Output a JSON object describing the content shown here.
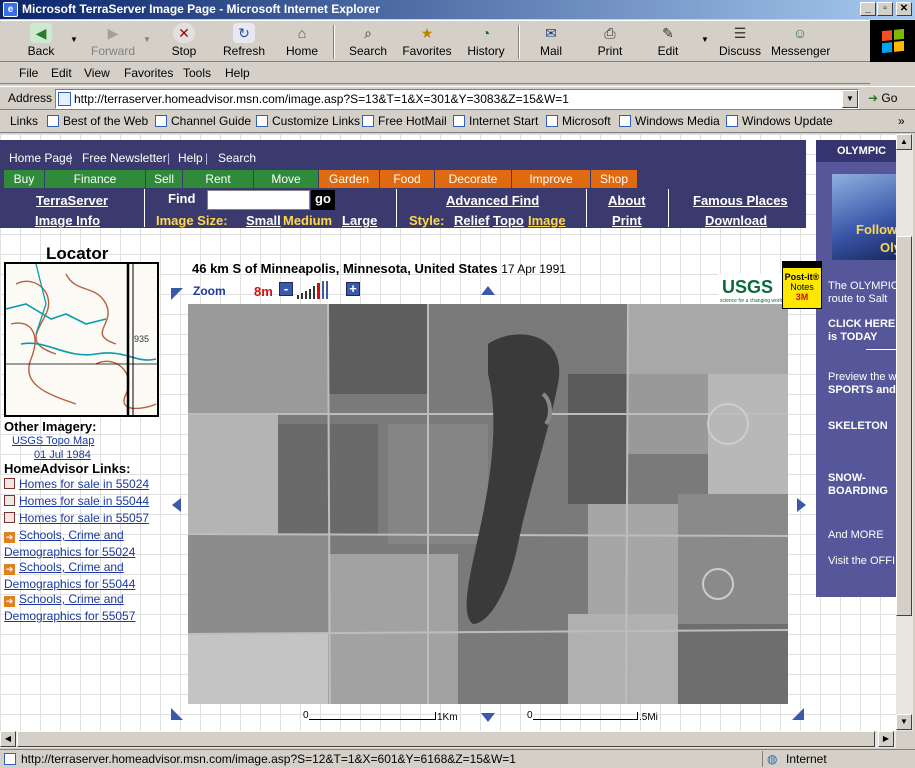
{
  "window": {
    "title": "Microsoft TerraServer Image Page - Microsoft Internet Explorer",
    "min": "_",
    "max": "▫",
    "close": "✕"
  },
  "toolbar": {
    "back": "Back",
    "forward": "Forward",
    "stop": "Stop",
    "refresh": "Refresh",
    "home": "Home",
    "search": "Search",
    "favorites": "Favorites",
    "history": "History",
    "mail": "Mail",
    "print": "Print",
    "edit": "Edit",
    "discuss": "Discuss",
    "messenger": "Messenger"
  },
  "menu": [
    "File",
    "Edit",
    "View",
    "Favorites",
    "Tools",
    "Help"
  ],
  "address": {
    "label": "Address",
    "url": "http://terraserver.homeadvisor.msn.com/image.asp?S=13&T=1&X=301&Y=3083&Z=15&W=1",
    "go": "Go"
  },
  "links": {
    "label": "Links",
    "items": [
      "Best of the Web",
      "Channel Guide",
      "Customize Links",
      "Free HotMail",
      "Internet Start",
      "Microsoft",
      "Windows Media",
      "Windows Update"
    ]
  },
  "site_nav": {
    "top": [
      "Home Page",
      "Free Newsletter",
      "Help",
      "Search"
    ],
    "categories": [
      "Buy",
      "Finance",
      "Sell",
      "Rent",
      "Move",
      "Garden",
      "Food",
      "Decorate",
      "Improve",
      "Shop"
    ],
    "terraserver": "TerraServer",
    "image_info": "Image Info",
    "find_label": "Find",
    "find_value": "",
    "go": "go",
    "image_size_label": "Image Size:",
    "size_small": "Small",
    "size_medium": "Medium",
    "size_large": "Large",
    "advanced_find": "Advanced Find",
    "style_label": "Style:",
    "style_relief": "Relief",
    "style_topo": "Topo",
    "style_image": "Image",
    "about": "About",
    "print": "Print",
    "famous_places": "Famous Places",
    "download": "Download"
  },
  "locator": {
    "title": "Locator",
    "map_label": "935",
    "other_imagery": "Other Imagery:",
    "topo_link": "USGS Topo Map",
    "topo_date": "01 Jul 1984",
    "homeadvisor_links": "HomeAdvisor Links:",
    "links": [
      {
        "type": "home",
        "text": "Homes for sale in 55024"
      },
      {
        "type": "home",
        "text": "Homes for sale in 55044"
      },
      {
        "type": "home",
        "text": "Homes for sale in 55057"
      },
      {
        "type": "arrow",
        "text": "Schools, Crime and",
        "text2": "Demographics for 55024"
      },
      {
        "type": "arrow",
        "text": "Schools, Crime and",
        "text2": "Demographics for 55044"
      },
      {
        "type": "arrow",
        "text": "Schools, Crime and",
        "text2": "Demographics for 55057"
      }
    ]
  },
  "image": {
    "title": "46 km S of Minneapolis, Minnesota, United States",
    "date": "17 Apr 1991",
    "zoom_label": "Zoom",
    "scale": "8m",
    "zoom_minus": "-",
    "zoom_plus": "+",
    "scale_km_start": "0",
    "scale_km_end": "1Km",
    "scale_mi_start": "0",
    "scale_mi_end": ".5Mi"
  },
  "usgs": {
    "logo": "USGS",
    "tagline": "science for a changing world"
  },
  "postit": {
    "line1": "Post-it®",
    "line2": "Notes",
    "brand": "3M"
  },
  "ad": {
    "header": "OLYMPIC",
    "photo_text1": "Follow",
    "photo_text2": "Olym",
    "lines": [
      "The OLYMPIC",
      "route to Salt",
      "CLICK HERE",
      "is TODAY",
      "Preview the w",
      "SPORTS and",
      "SKELETON",
      "SNOW-",
      "BOARDING",
      "And MORE",
      "Visit the OFFI"
    ]
  },
  "status": {
    "url": "http://terraserver.homeadvisor.msn.com/image.asp?S=12&T=1&X=601&Y=6168&Z=15&W=1",
    "zone": "Internet"
  },
  "colors": {
    "nav_bg": "#3a3a6e",
    "green": "#2f8a3a",
    "orange": "#e06a10",
    "ad_bg": "#56579a",
    "titlebar": "#0a246a"
  }
}
